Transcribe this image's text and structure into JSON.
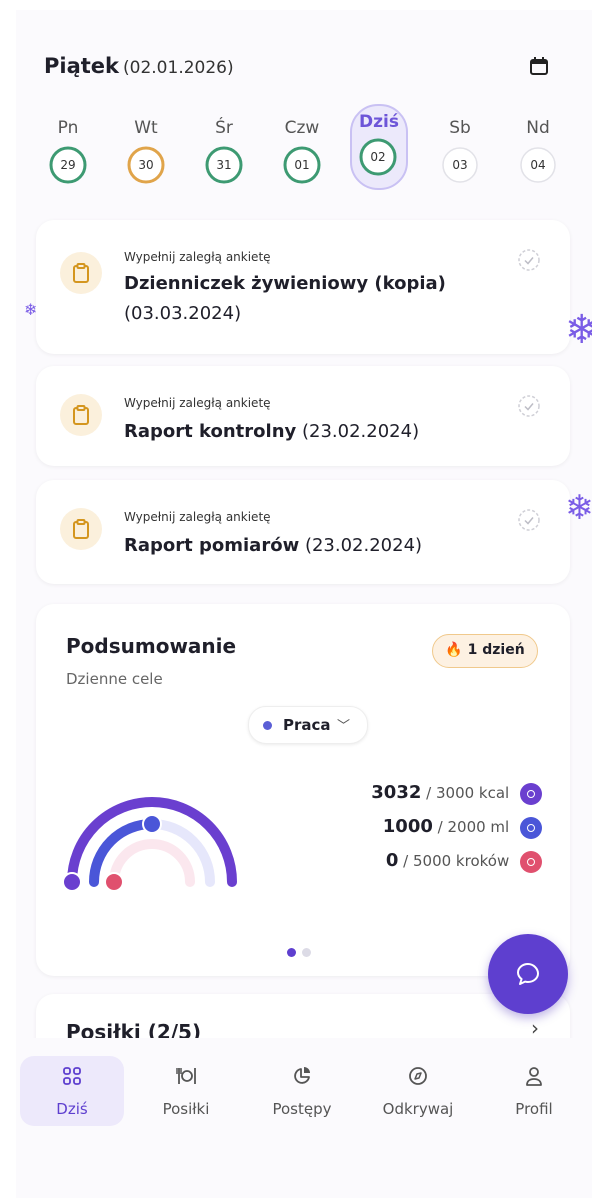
{
  "header": {
    "day_name": "Piątek",
    "date": "(02.01.2026)"
  },
  "week": [
    {
      "label": "Pn",
      "num": "29",
      "color": "#3d9a72",
      "fill": 1.0,
      "today": false
    },
    {
      "label": "Wt",
      "num": "30",
      "color": "#e0a44a",
      "fill": 1.0,
      "today": false
    },
    {
      "label": "Śr",
      "num": "31",
      "color": "#3d9a72",
      "fill": 1.0,
      "today": false
    },
    {
      "label": "Czw",
      "num": "01",
      "color": "#3d9a72",
      "fill": 1.0,
      "today": false
    },
    {
      "label": "Dziś",
      "num": "02",
      "color": "#3d9a72",
      "fill": 1.0,
      "today": true
    },
    {
      "label": "Sb",
      "num": "03",
      "color": "#d9d9df",
      "fill": 0,
      "today": false
    },
    {
      "label": "Nd",
      "num": "04",
      "color": "#d9d9df",
      "fill": 0,
      "today": false
    }
  ],
  "surveys": [
    {
      "subtitle": "Wypełnij zaległą ankietę",
      "title": "Dzienniczek żywieniowy (kopia)",
      "date": "(03.03.2024)"
    },
    {
      "subtitle": "Wypełnij zaległą ankietę",
      "title": "Raport kontrolny",
      "date": "(23.02.2024)"
    },
    {
      "subtitle": "Wypełnij zaległą ankietę",
      "title": "Raport pomiarów",
      "date": "(23.02.2024)"
    }
  ],
  "summary": {
    "title": "Podsumowanie",
    "subtitle": "Dzienne cele",
    "streak": "1 dzień",
    "mode": "Praca",
    "stats": [
      {
        "value": "3032",
        "target": "/ 3000 kcal",
        "color": "#6a3fcf",
        "progress": 1.0
      },
      {
        "value": "1000",
        "target": "/ 2000 ml",
        "color": "#4a56d8",
        "progress": 0.5
      },
      {
        "value": "0",
        "target": "/ 5000 kroków",
        "color": "#e0506e",
        "progress": 0.0
      }
    ]
  },
  "meals": {
    "title": "Posiłki (2/5)"
  },
  "nav": [
    {
      "label": "Dziś",
      "active": true
    },
    {
      "label": "Posiłki",
      "active": false
    },
    {
      "label": "Postępy",
      "active": false
    },
    {
      "label": "Odkrywaj",
      "active": false
    },
    {
      "label": "Profil",
      "active": false
    }
  ],
  "colors": {
    "accent": "#5e3fcf",
    "today_bg": "#ece9fb",
    "streak_border": "#f0c98c"
  },
  "icons": [
    "calendar-icon",
    "clipboard-icon",
    "check-circle-icon",
    "fire-icon",
    "chevron-down-icon",
    "chat-bubble-icon",
    "grid-icon",
    "cutlery-icon",
    "pie-chart-icon",
    "compass-icon",
    "user-icon",
    "snowflake-icon"
  ]
}
